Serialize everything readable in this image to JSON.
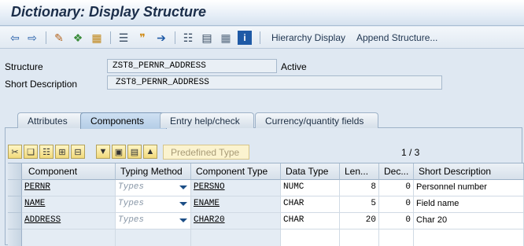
{
  "window": {
    "title": "Dictionary: Display Structure"
  },
  "toolbar": {
    "icons": [
      "back-arrow-icon",
      "forward-arrow-icon",
      "edit-pencil-icon",
      "change-display-icon",
      "activate-icon",
      "where-used-icon",
      "inspect-icon",
      "object-list-icon",
      "hierarchy-icon",
      "print-icon",
      "table-view-icon",
      "info-icon"
    ],
    "hierarchy_display": "Hierarchy Display",
    "append_structure": "Append Structure..."
  },
  "header": {
    "structure_label": "Structure",
    "structure_value": "ZST8_PERNR_ADDRESS",
    "status": "Active",
    "short_desc_label": "Short Description",
    "short_desc_value": "ZST8_PERNR_ADDRESS"
  },
  "tabs": [
    {
      "label": "Attributes",
      "active": false
    },
    {
      "label": "Components",
      "active": true
    },
    {
      "label": "Entry help/check",
      "active": false
    },
    {
      "label": "Currency/quantity fields",
      "active": false
    }
  ],
  "table_toolbar": {
    "icons": [
      "cut-icon",
      "copy-icon",
      "paste-icon",
      "insert-row-icon",
      "delete-row-icon",
      "insert-include-icon",
      "new-rows-icon",
      "sort-icon",
      "top-icon"
    ],
    "predefined_type": "Predefined Type",
    "page_indicator": "1 / 3"
  },
  "grid": {
    "headers": [
      "Component",
      "Typing Method",
      "Component Type",
      "Data Type",
      "Len...",
      "Dec...",
      "Short Description"
    ],
    "rows": [
      {
        "component": "PERNR",
        "typing": "Types",
        "comp_type": "PERSNO",
        "data_type": "NUMC",
        "length": "8",
        "decimals": "0",
        "desc": "Personnel number"
      },
      {
        "component": "NAME",
        "typing": "Types",
        "comp_type": "ENAME",
        "data_type": "CHAR",
        "length": "5",
        "decimals": "0",
        "desc": "Field name"
      },
      {
        "component": "ADDRESS",
        "typing": "Types",
        "comp_type": "CHAR20",
        "data_type": "CHAR",
        "length": "20",
        "decimals": "0",
        "desc": "Char 20"
      }
    ]
  },
  "colors": {
    "accent": "#1c4e86",
    "background": "#dfe8f2",
    "active_tab": "#b4cde6"
  }
}
